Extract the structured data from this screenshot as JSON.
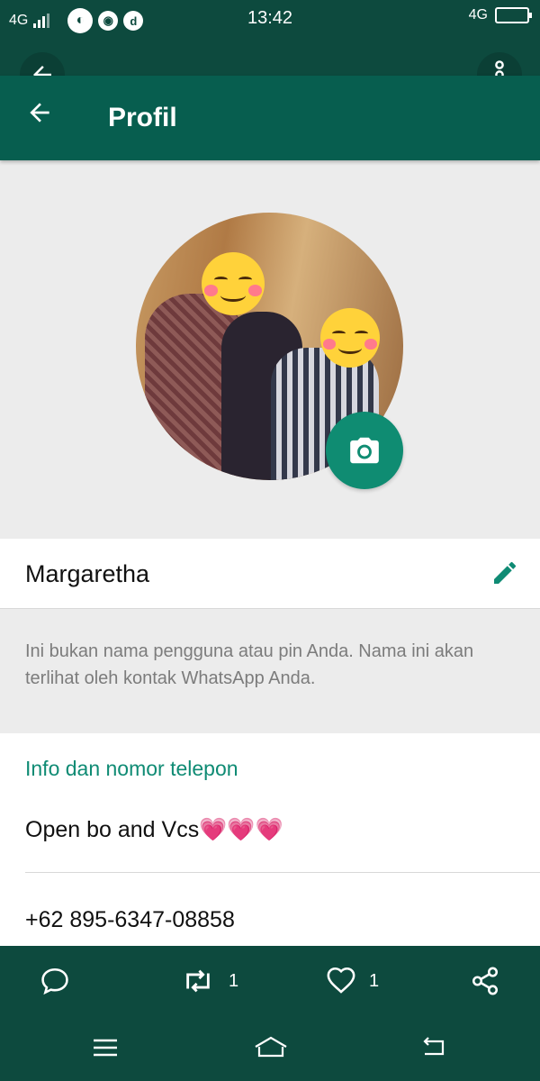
{
  "status_bar": {
    "network_left": "4G",
    "time": "13:42",
    "network_right": "4G"
  },
  "app_bar": {
    "title": "Profil"
  },
  "profile": {
    "name": "Margaretha",
    "name_hint": "Ini bukan nama pengguna atau pin Anda. Nama ini akan terlihat oleh kontak WhatsApp Anda.",
    "section_label": "Info dan nomor telepon",
    "about": "Open bo and Vcs💗💗💗",
    "phone": "+62 895-6347-08858"
  },
  "action_bar": {
    "retweet_count": "1",
    "like_count": "1"
  },
  "colors": {
    "header": "#075e4f",
    "status_bar": "#0d4a3e",
    "accent": "#0f8b74",
    "background": "#ececec"
  },
  "icons": [
    "back-arrow-icon",
    "more-vert-icon",
    "camera-icon",
    "edit-pencil-icon",
    "comment-icon",
    "retweet-icon",
    "heart-icon",
    "share-icon",
    "menu-icon",
    "home-icon",
    "back-nav-icon"
  ]
}
